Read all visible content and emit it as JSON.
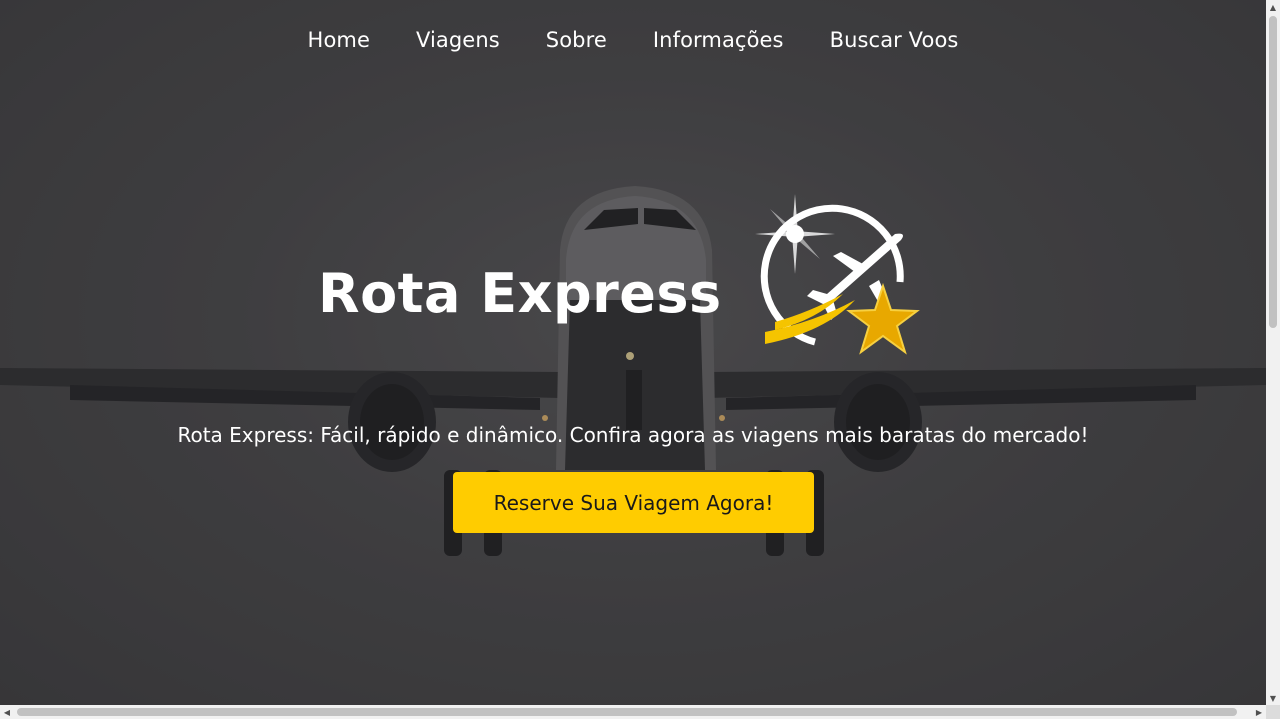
{
  "nav": {
    "items": [
      {
        "label": "Home"
      },
      {
        "label": "Viagens"
      },
      {
        "label": "Sobre"
      },
      {
        "label": "Informações"
      },
      {
        "label": "Buscar Voos"
      }
    ]
  },
  "hero": {
    "title": "Rota Express",
    "tagline": "Rota Express: Fácil, rápido e dinâmico. Confira agora as viagens mais baratas do mercado!",
    "cta_label": "Reserve Sua Viagem Agora!",
    "background_icon": "airplane-photo",
    "logo_icon": "airplane-star-logo"
  },
  "colors": {
    "accent": "#ffcc00",
    "text": "#ffffff",
    "background": "#4a494b"
  }
}
